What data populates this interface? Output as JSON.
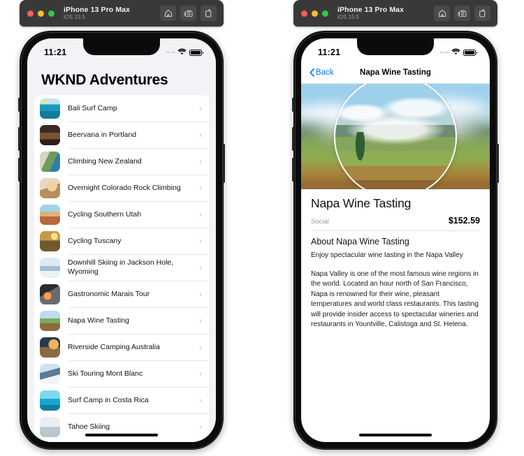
{
  "window": {
    "device_name": "iPhone 13 Pro Max",
    "os_version": "iOS 15.5",
    "toolbar_icons": [
      "home-icon",
      "screenshot-camera-icon",
      "record-icon"
    ]
  },
  "status_bar": {
    "time": "11:21",
    "icons": [
      "cellular-signal-icon",
      "wifi-icon",
      "battery-icon"
    ]
  },
  "list_screen": {
    "title": "WKND Adventures",
    "items": [
      {
        "label": "Bali Surf Camp",
        "thumb": "ph-bali"
      },
      {
        "label": "Beervana in Portland",
        "thumb": "ph-beer"
      },
      {
        "label": "Climbing New Zealand",
        "thumb": "ph-climb"
      },
      {
        "label": "Overnight Colorado Rock Climbing",
        "thumb": "ph-overn"
      },
      {
        "label": "Cycling Southern Utah",
        "thumb": "ph-utah"
      },
      {
        "label": "Cycling Tuscany",
        "thumb": "ph-tusc"
      },
      {
        "label": "Downhill Skiing in Jackson Hole, Wyoming",
        "thumb": "ph-down"
      },
      {
        "label": "Gastronomic Marais Tour",
        "thumb": "ph-gastr"
      },
      {
        "label": "Napa Wine Tasting",
        "thumb": "ph-napa"
      },
      {
        "label": "Riverside Camping Australia",
        "thumb": "ph-river"
      },
      {
        "label": "Ski Touring Mont Blanc",
        "thumb": "ph-ski"
      },
      {
        "label": "Surf Camp in Costa Rica",
        "thumb": "ph-surf"
      },
      {
        "label": "Tahoe Skiing",
        "thumb": "ph-tahoe"
      }
    ],
    "chevron": "›"
  },
  "detail_screen": {
    "back_label": "Back",
    "nav_title": "Napa Wine Tasting",
    "hero_image": "napa-vineyard-photo",
    "title": "Napa Wine Tasting",
    "category": "Social",
    "price": "$152.59",
    "about_heading": "About Napa Wine Tasting",
    "lead": "Enjoy spectacular wine tasting in the Napa Valley",
    "body": "Napa Valley is one of the most famous wine regions in the world. Located an hour north of San Francisco, Napa is renowned for their wine, pleasant temperatures and world class restaurants. This tasting will provide insider access to spectacular wineries and restaurants in Yountville, Calistoga and St. Helena."
  },
  "colors": {
    "accent_blue": "#007aff",
    "list_background": "#f2f2f7",
    "titlebar": "#393939"
  }
}
